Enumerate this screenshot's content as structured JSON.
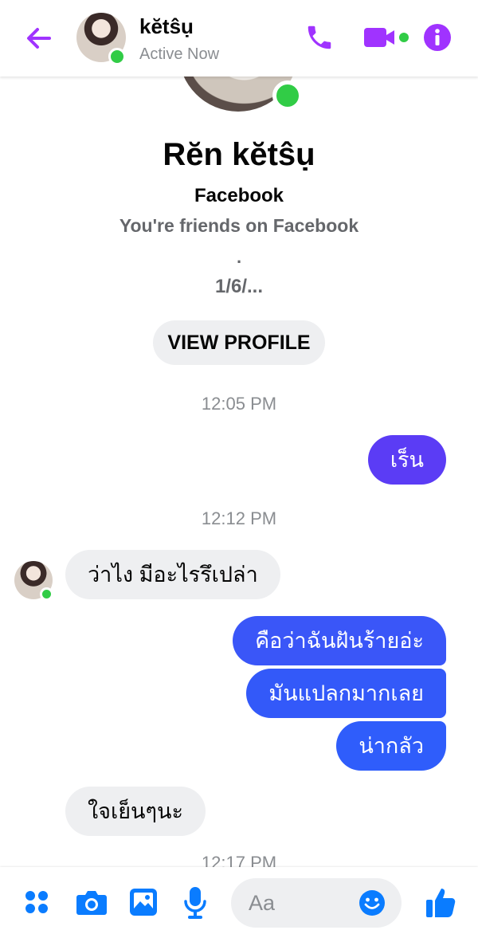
{
  "header": {
    "title": "kĕtŝụ",
    "status": "Active Now"
  },
  "profile": {
    "name": "Rĕn kĕtŝụ",
    "network": "Facebook",
    "friends_text": "You're friends on Facebook",
    "separator": ".",
    "date_text": "1/6/...",
    "view_profile_label": "VIEW PROFILE"
  },
  "timestamps": [
    "12:05 PM",
    "12:12 PM",
    "12:17 PM"
  ],
  "messages": [
    {
      "from": "me",
      "text": "เร็น"
    },
    {
      "from": "them",
      "text": "ว่าไง มีอะไรรึเปล่า"
    },
    {
      "from": "me",
      "text": "คือว่าฉันฝันร้ายอ่ะ"
    },
    {
      "from": "me",
      "text": "มันแปลกมากเลย"
    },
    {
      "from": "me",
      "text": "น่ากลัว"
    },
    {
      "from": "them",
      "text": "ใจเย็นๆนะ"
    }
  ],
  "composer": {
    "placeholder": "Aa"
  },
  "colors": {
    "accent_purple": "#a033ff",
    "outgoing_top": "#5b3cf5",
    "outgoing_bottom": "#2f5dfb",
    "icon_blue": "#0a7cff",
    "online_green": "#31cc46"
  },
  "icons": [
    "back-arrow-icon",
    "phone-icon",
    "video-camera-icon",
    "info-icon",
    "apps-icon",
    "camera-icon",
    "gallery-icon",
    "microphone-icon",
    "emoji-icon",
    "thumbs-up-icon"
  ]
}
